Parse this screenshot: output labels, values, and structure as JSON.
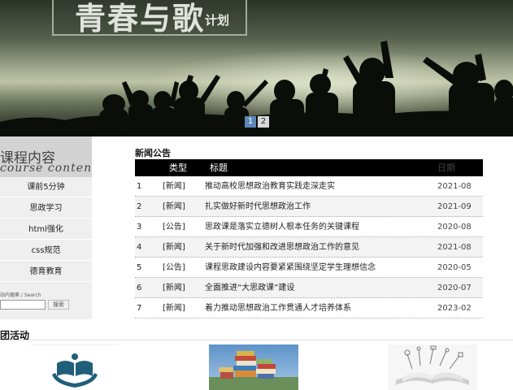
{
  "banner": {
    "title_main": "青春与歌",
    "title_sub": "计划",
    "pages": [
      "1",
      "2"
    ],
    "active_page": "1"
  },
  "sidebar": {
    "heading_cn": "课程内容",
    "heading_en": "course content",
    "items": [
      "课前5分钟",
      "思政学习",
      "html强化",
      "css规范",
      "德育教育"
    ],
    "search_label": "站内搜索 / Search",
    "search_placeholder": "",
    "search_button": "搜索"
  },
  "news": {
    "title": "新闻公告",
    "columns": [
      "",
      "类型",
      "标题",
      "日期"
    ],
    "rows": [
      {
        "num": "1",
        "type": "[新闻]",
        "title": "推动高校思想政治教育实践走深走实",
        "date": "2021-08"
      },
      {
        "num": "2",
        "type": "[新闻]",
        "title": "扎实做好新时代思想政治工作",
        "date": "2021-09"
      },
      {
        "num": "3",
        "type": "[公告]",
        "title": "思政课是落实立德树人根本任务的关键课程",
        "date": "2020-08"
      },
      {
        "num": "4",
        "type": "[新闻]",
        "title": "关于新时代加强和改进思想政治工作的意见",
        "date": "2021-08"
      },
      {
        "num": "5",
        "type": "[公告]",
        "title": "课程思政建设内容要紧紧围绕坚定学生理想信念",
        "date": "2020-05"
      },
      {
        "num": "6",
        "type": "[新闻]",
        "title": "全面推进“大思政课”建设",
        "date": "2020-07"
      },
      {
        "num": "7",
        "type": "[新闻]",
        "title": "着力推动思想政治工作贯通人才培养体系",
        "date": "2023-02"
      }
    ]
  },
  "activities": {
    "title": "团活动"
  },
  "colors": {
    "pager_active": "#5c87b8",
    "table_header": "#000000",
    "book_icon": "#1f5f7a"
  }
}
